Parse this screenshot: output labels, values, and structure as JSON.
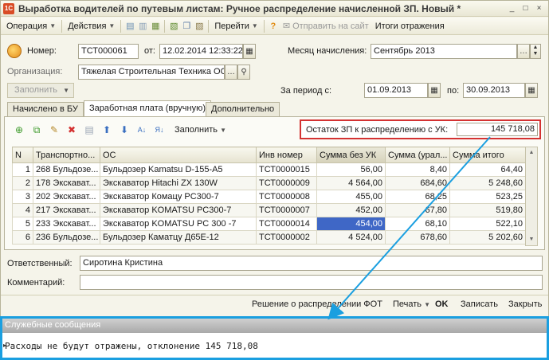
{
  "window": {
    "title": "Выработка водителей по путевым листам: Ручное распределение начисленной ЗП. Новый *",
    "minimize": "_",
    "maximize": "□",
    "close": "×"
  },
  "toolbar": {
    "operation": "Операция",
    "actions": "Действия",
    "goto": "Перейти",
    "send_site": "Отправить на сайт",
    "reflection": "Итоги отражения"
  },
  "form": {
    "number_label": "Номер:",
    "number_value": "ТСТ000061",
    "from_label": "от:",
    "date_value": "12.02.2014 12:33:22",
    "month_label": "Месяц начисления:",
    "month_value": "Сентябрь 2013",
    "org_label": "Организация:",
    "org_value": "Тяжелая Строительная Техника ОО",
    "fill_label": "Заполнить",
    "period_label": "За период с:",
    "period_from": "01.09.2013",
    "period_to_label": "по:",
    "period_to": "30.09.2013"
  },
  "tabs": [
    {
      "label": "Начислено в БУ"
    },
    {
      "label": "Заработная плата (вручную)"
    },
    {
      "label": "Дополнительно"
    }
  ],
  "grid_toolbar": {
    "fill_label": "Заполнить",
    "remain_label": "Остаток ЗП к распределению с УК:",
    "remain_value": "145 718,08"
  },
  "table": {
    "columns": [
      "N",
      "Транспортно...",
      "ОС",
      "Инв номер",
      "Сумма без УК",
      "Сумма (урал...",
      "Сумма итого"
    ],
    "rows": [
      [
        "1",
        "268 Бульдозе...",
        "Бульдозер Kamatsu D-155-A5",
        "ТСТ0000015",
        "56,00",
        "8,40",
        "64,40"
      ],
      [
        "2",
        "178 Экскават...",
        "Экскаватор Hitachi ZX 130W",
        "ТСТ0000009",
        "4 564,00",
        "684,60",
        "5 248,60"
      ],
      [
        "3",
        "202 Экскават...",
        "Экскаватор Комацу PC300-7",
        "ТСТ0000008",
        "455,00",
        "68,25",
        "523,25"
      ],
      [
        "4",
        "217 Экскават...",
        "Экскаватор KOMATSU PC300-7",
        "ТСТ0000007",
        "452,00",
        "67,80",
        "519,80"
      ],
      [
        "5",
        "233 Экскават...",
        "Экскаватор KOMATSU PC 300 -7",
        "ТСТ0000014",
        "454,00",
        "68,10",
        "522,10"
      ],
      [
        "6",
        "236 Бульдозе...",
        "Бульдозер Каматцу Д65Е-12",
        "ТСТ0000002",
        "4 524,00",
        "678,60",
        "5 202,60"
      ]
    ]
  },
  "bottom": {
    "responsible_label": "Ответственный:",
    "responsible_value": "Сиротина Кристина",
    "comment_label": "Комментарий:",
    "comment_value": ""
  },
  "footer": {
    "decision": "Решение о распределении ФОТ",
    "print": "Печать",
    "ok": "OK",
    "save": "Записать",
    "close": "Закрыть"
  },
  "messages": {
    "header": "Служебные сообщения",
    "text": "Расходы не будут отражены, отклонение 145 718,08"
  },
  "colors": {
    "highlight_box": "#d43232",
    "arrow": "#1a9fe0",
    "selected_cell": "#3f67c6"
  }
}
